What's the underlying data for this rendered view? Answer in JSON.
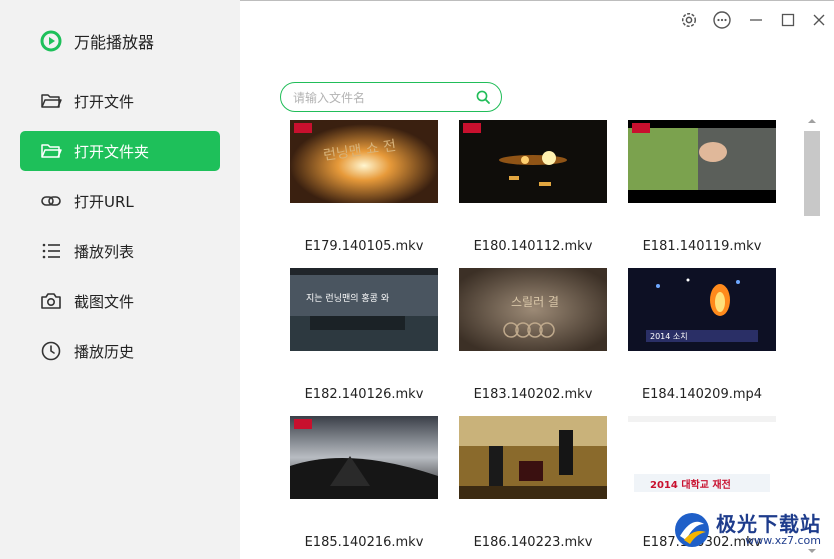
{
  "app": {
    "title": "万能播放器"
  },
  "sidebar": {
    "items": [
      {
        "label": "打开文件",
        "icon": "folder-icon",
        "active": false
      },
      {
        "label": "打开文件夹",
        "icon": "folder-open-icon",
        "active": true
      },
      {
        "label": "打开URL",
        "icon": "link-icon",
        "active": false
      },
      {
        "label": "播放列表",
        "icon": "list-icon",
        "active": false
      },
      {
        "label": "截图文件",
        "icon": "camera-icon",
        "active": false
      },
      {
        "label": "播放历史",
        "icon": "clock-icon",
        "active": false
      }
    ]
  },
  "window_controls": [
    "settings-icon",
    "more-icon",
    "minimize-icon",
    "maximize-icon",
    "close-icon"
  ],
  "search": {
    "placeholder": "请输入文件名",
    "value": ""
  },
  "files": [
    {
      "name": "E179.140105.mkv",
      "thumb_text": "런닝맨 쇼 전"
    },
    {
      "name": "E180.140112.mkv",
      "thumb_text": ""
    },
    {
      "name": "E181.140119.mkv",
      "thumb_text": ""
    },
    {
      "name": "E182.140126.mkv",
      "thumb_text": "지는 런닝맨의 홍콩 와"
    },
    {
      "name": "E183.140202.mkv",
      "thumb_text": "스릴러 결"
    },
    {
      "name": "E184.140209.mp4",
      "thumb_text": "2014 소치"
    },
    {
      "name": "E185.140216.mkv",
      "thumb_text": ""
    },
    {
      "name": "E186.140223.mkv",
      "thumb_text": ""
    },
    {
      "name": "E187.140302.mkv",
      "thumb_text": "2014 대학교 재전"
    }
  ],
  "watermark": {
    "title": "极光下载站",
    "url": "www.xz7.com"
  },
  "colors": {
    "accent": "#1ec05a",
    "sidebar_bg": "#f2f2f2",
    "text": "#222222"
  }
}
